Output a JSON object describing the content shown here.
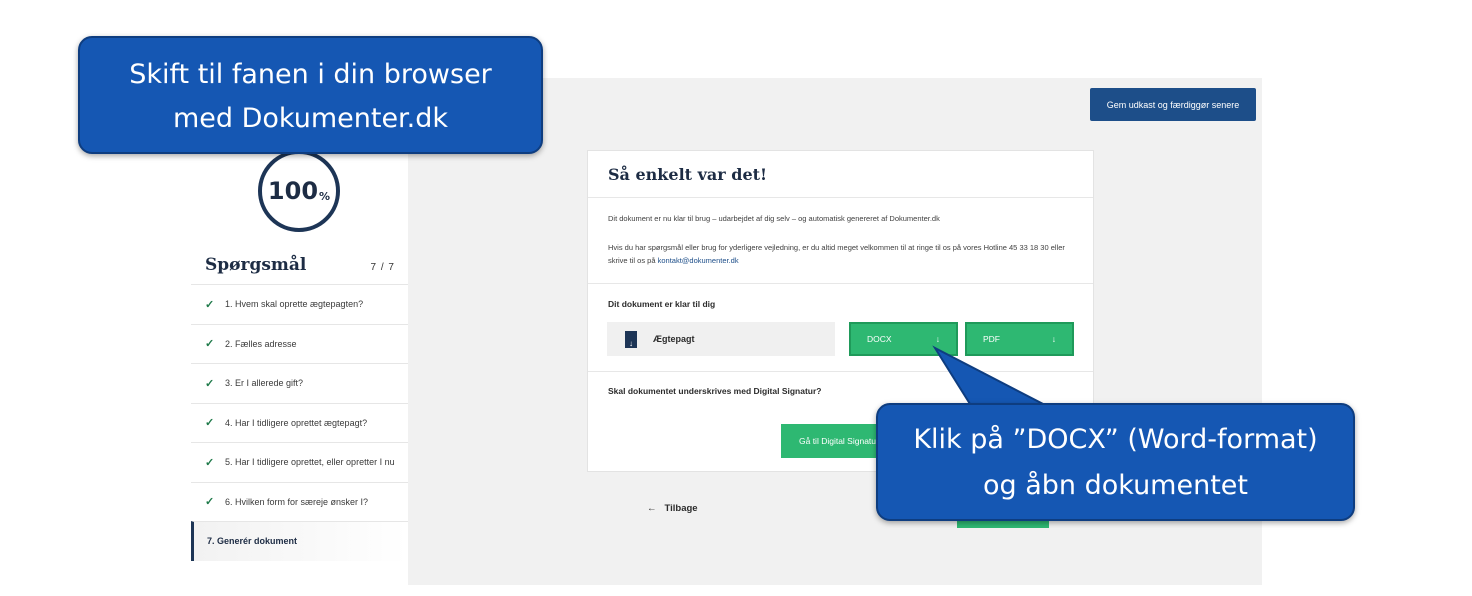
{
  "sidebar": {
    "progress_value": "100",
    "progress_unit": "%",
    "title": "Spørgsmål",
    "count": "7 / 7",
    "items": [
      {
        "label": "1. Hvem skal oprette ægtepagten?",
        "done": true
      },
      {
        "label": "2. Fælles adresse",
        "done": true
      },
      {
        "label": "3. Er I allerede gift?",
        "done": true
      },
      {
        "label": "4. Har I tidligere oprettet ægtepagt?",
        "done": true
      },
      {
        "label": "5. Har I tidligere oprettet, eller opretter I nu",
        "done": true
      },
      {
        "label": "6. Hvilken form for særeje ønsker I?",
        "done": true
      },
      {
        "label": "7. Generér dokument",
        "done": false,
        "active": true
      }
    ],
    "check_icon": "✓"
  },
  "header": {
    "save_draft_label": "Gem udkast og færdiggør senere"
  },
  "card": {
    "title": "Så enkelt var det!",
    "intro": "Dit dokument er nu klar til brug – udarbejdet af dig selv – og automatisk genereret af Dokumenter.dk",
    "help_text": "Hvis du har spørgsmål eller brug for yderligere vejledning, er du altid meget velkommen til at ringe til os på vores Hotline 45 33 18 30 eller skrive til os på ",
    "help_email": "kontakt@dokumenter.dk",
    "ready_label": "Dit dokument er klar til dig",
    "document_name": "Ægtepagt",
    "docx_label": "DOCX",
    "pdf_label": "PDF",
    "download_icon": "↓",
    "sign_question": "Skal dokumentet underskrives med Digital Signatur?",
    "digital_signature_label": "Gå til Digital Signatur"
  },
  "footer": {
    "back_label": "Tilbage",
    "back_icon": "←"
  },
  "callouts": {
    "switch_tab": [
      "Skift til fanen i din browser",
      "med Dokumenter.dk"
    ],
    "click_docx": [
      "Klik på ”DOCX” (Word-format)",
      "og åbn dokumentet"
    ]
  },
  "colors": {
    "accent_blue": "#1d4e89",
    "callout_blue": "#1557b3",
    "green": "#2eb872",
    "navy": "#1d3556"
  }
}
